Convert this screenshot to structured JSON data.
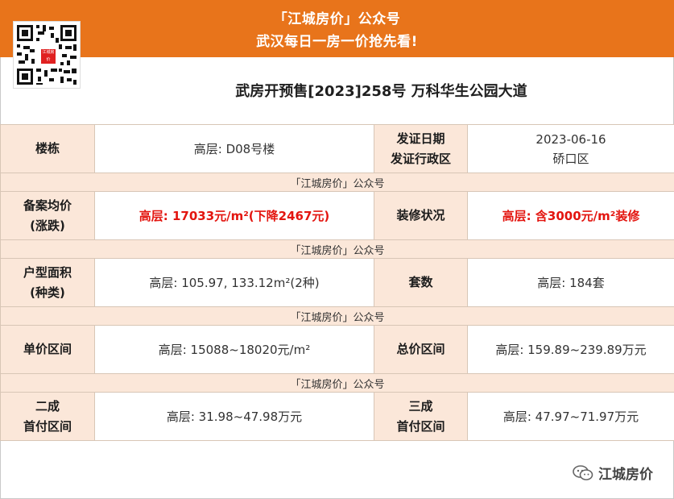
{
  "banner": {
    "line1": "「江城房价」公众号",
    "line2": "武汉每日一房一价抢先看!",
    "qr_label": "江城房价"
  },
  "title": "武房开预售[2023]258号 万科华生公园大道",
  "watermark": "「江城房价」公众号",
  "rows": {
    "building": {
      "label": "楼栋",
      "value": "高层: D08号楼"
    },
    "cert": {
      "label1": "发证日期",
      "label2": "发证行政区",
      "value1": "2023-06-16",
      "value2": "硚口区"
    },
    "price": {
      "label1": "备案均价",
      "label2": "(涨跌)",
      "value": "高层: 17033元/m²(下降2467元)"
    },
    "decoration": {
      "label": "装修状况",
      "value": "高层: 含3000元/m²装修"
    },
    "area": {
      "label1": "户型面积",
      "label2": "(种类)",
      "value": "高层: 105.97, 133.12m²(2种)"
    },
    "units": {
      "label": "套数",
      "value": "高层: 184套"
    },
    "unit_price": {
      "label": "单价区间",
      "value": "高层: 15088~18020元/m²"
    },
    "total_price": {
      "label": "总价区间",
      "value": "高层: 159.89~239.89万元"
    },
    "down20": {
      "label1": "二成",
      "label2": "首付区间",
      "value": "高层: 31.98~47.98万元"
    },
    "down30": {
      "label1": "三成",
      "label2": "首付区间",
      "value": "高层: 47.97~71.97万元"
    }
  },
  "footer": {
    "text": "江城房价",
    "icon": "wechat-icon"
  },
  "colors": {
    "banner": "#e8741b",
    "label_bg": "#fbe7d9",
    "highlight": "#e3150f"
  }
}
